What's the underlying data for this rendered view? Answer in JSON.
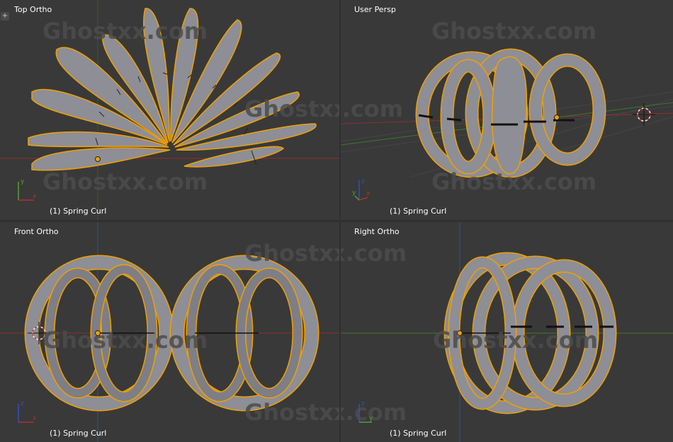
{
  "viewports": {
    "top_left": {
      "label": "Top Ortho",
      "object_label": "(1) Spring Curl",
      "axes": {
        "a": "x",
        "b": "y"
      }
    },
    "top_right": {
      "label": "User Persp",
      "object_label": "(1) Spring Curl",
      "axes": {
        "a": "x",
        "b": "y",
        "c": "z"
      }
    },
    "bottom_left": {
      "label": "Front Ortho",
      "object_label": "(1) Spring Curl",
      "axes": {
        "a": "x",
        "b": "z"
      }
    },
    "bottom_right": {
      "label": "Right Ortho",
      "object_label": "(1) Spring Curl",
      "axes": {
        "a": "y",
        "b": "z"
      }
    }
  },
  "watermark": "Ghostxx.com",
  "colors": {
    "viewport_bg": "#393939",
    "object": "#8e8e96",
    "selection_outline": "#f0a000",
    "x_axis": "#b03030",
    "y_axis": "#50a030",
    "z_axis": "#3050c0"
  }
}
